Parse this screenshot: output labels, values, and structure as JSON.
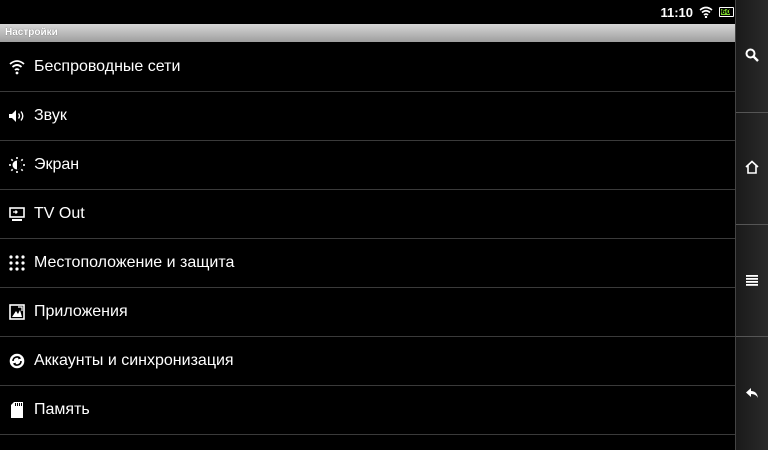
{
  "status": {
    "time": "11:10",
    "battery_level": "60",
    "battery_color": "#7cd62a"
  },
  "title": "Настройки",
  "items": [
    {
      "label": "Беспроводные сети",
      "icon": "wifi-icon"
    },
    {
      "label": "Звук",
      "icon": "speaker-icon"
    },
    {
      "label": "Экран",
      "icon": "brightness-icon"
    },
    {
      "label": "TV Out",
      "icon": "tv-out-icon"
    },
    {
      "label": "Местоположение и защита",
      "icon": "location-grid-icon"
    },
    {
      "label": "Приложения",
      "icon": "applications-icon"
    },
    {
      "label": "Аккаунты и синхронизация",
      "icon": "sync-icon"
    },
    {
      "label": "Память",
      "icon": "sd-card-icon"
    }
  ],
  "navbar": {
    "buttons": [
      "search-icon",
      "home-icon",
      "menu-icon",
      "back-icon"
    ]
  }
}
